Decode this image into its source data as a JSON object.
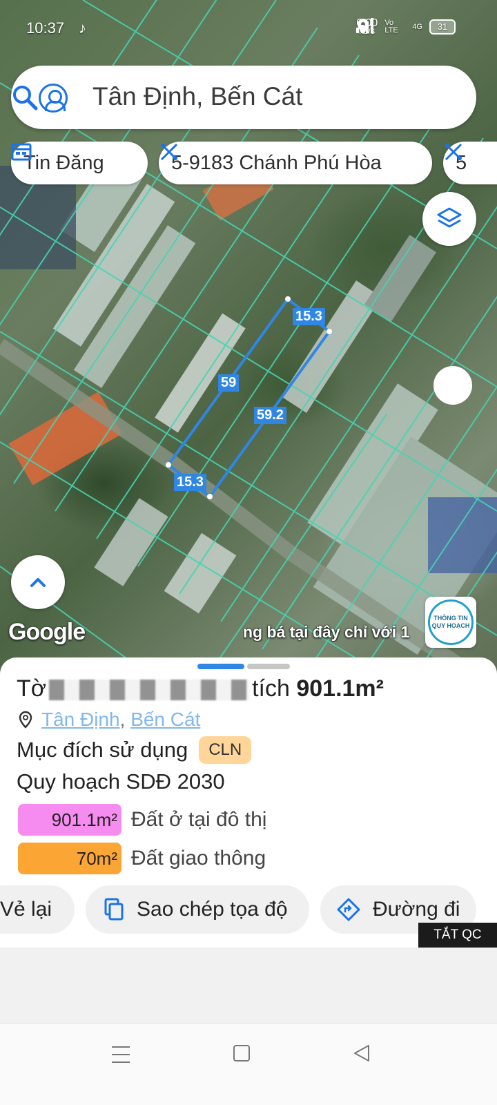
{
  "status_bar": {
    "time": "10:37",
    "app_icon": "tiktok-icon",
    "speed_value": "6.00",
    "speed_unit": "KB/S",
    "network_label": "Vo LTE",
    "signal_label": "4G",
    "battery": "31"
  },
  "search": {
    "value": "Tân Định, Bến Cát",
    "profile_icon": "user-icon",
    "action_icon": "search-icon"
  },
  "chips": [
    {
      "label": "Tin Đăng",
      "icon": "calendar-icon"
    },
    {
      "label": "5-9183 Chánh Phú Hòa",
      "icon": "ruler-icon"
    },
    {
      "label": "5",
      "icon": "ruler-icon"
    }
  ],
  "map": {
    "edge_labels": [
      "15.3",
      "59",
      "59.2",
      "15.3"
    ],
    "google_logo": "Google",
    "ad_text": "ng bá tại đây chỉ với 1",
    "planning_badge": "THÔNG TIN QUY HOẠCH"
  },
  "sheet": {
    "title_prefix": "Tờ",
    "title_suffix": "tích",
    "area": "901.1m²",
    "address_ward": "Tân Định",
    "address_sep": ",",
    "address_district": "Bến Cát",
    "purpose_label": "Mục đích sử dụng",
    "purpose_code": "CLN",
    "plan_title": "Quy hoạch SDĐ 2030",
    "zones": [
      {
        "value": "901.1m²",
        "label": "Đất ở tại đô thị",
        "color": "#f78cf0"
      },
      {
        "value": "70m²",
        "label": "Đất giao thông",
        "color": "#fba534"
      }
    ],
    "actions": [
      {
        "label": "Vẻ lại"
      },
      {
        "label": "Sao chép tọa độ",
        "icon": "copy-icon"
      },
      {
        "label": "Đường đi",
        "icon": "directions-icon"
      }
    ]
  },
  "ad_close": "TẮT QC",
  "colors": {
    "accent": "#1a73e8",
    "parcel_outline": "#2f87e3",
    "cadastral_lines": "#47d3b3"
  }
}
